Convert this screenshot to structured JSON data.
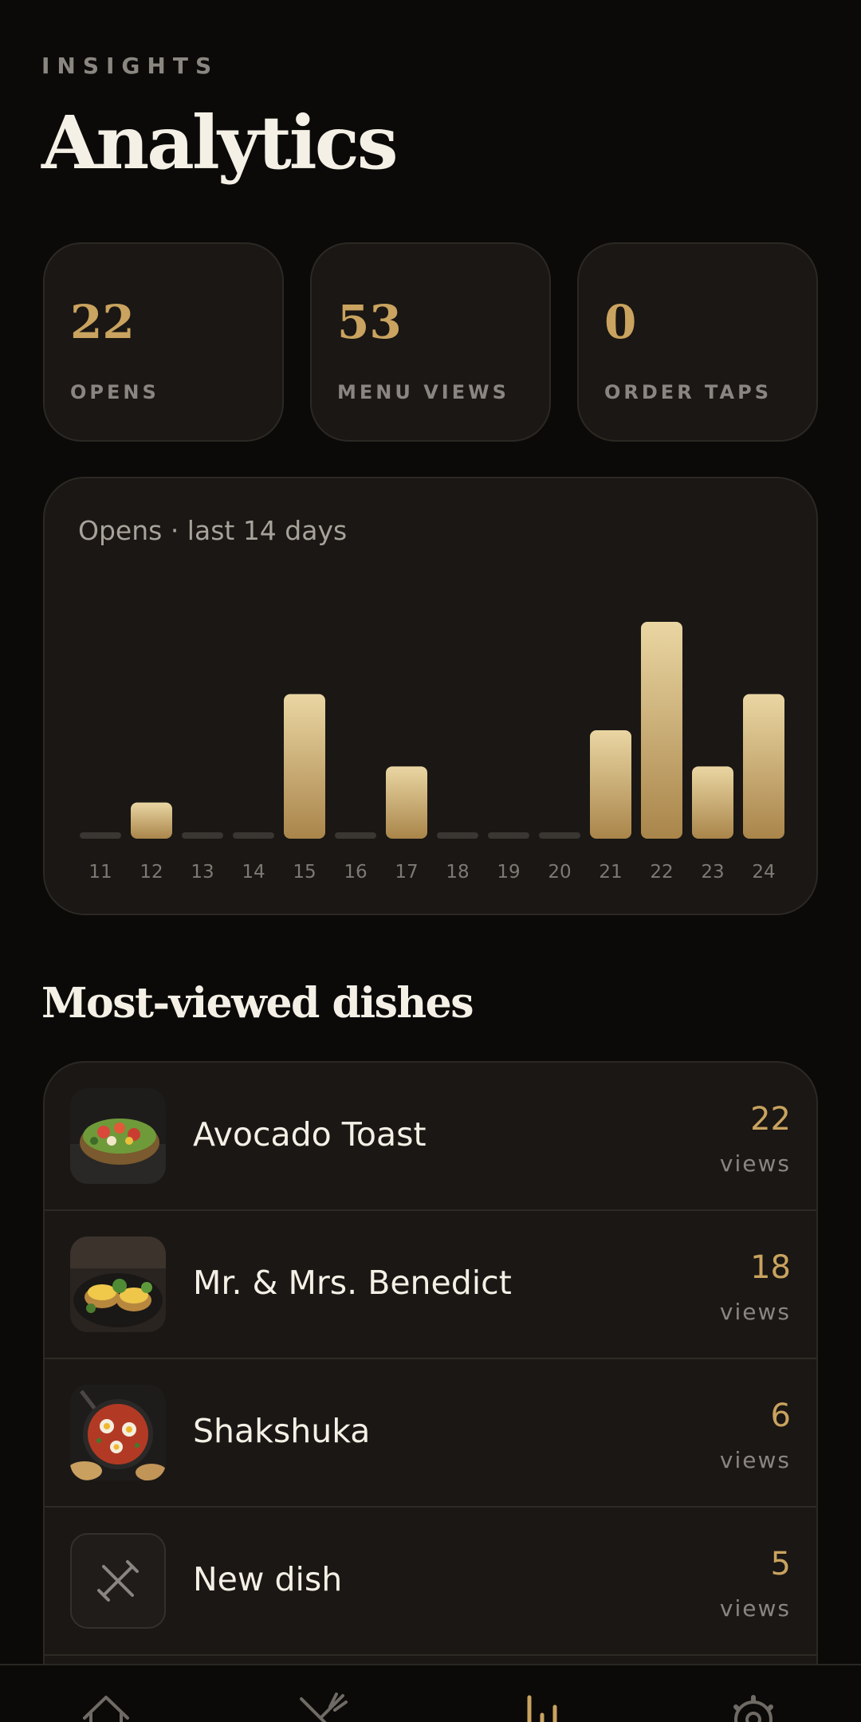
{
  "header": {
    "eyebrow": "INSIGHTS",
    "title": "Analytics"
  },
  "stats": [
    {
      "value": "22",
      "label": "OPENS"
    },
    {
      "value": "53",
      "label": "MENU VIEWS"
    },
    {
      "value": "0",
      "label": "ORDER TAPS"
    }
  ],
  "chart": {
    "title": "Opens · last 14 days"
  },
  "chart_data": {
    "type": "bar",
    "title": "Opens · last 14 days",
    "categories": [
      "11",
      "12",
      "13",
      "14",
      "15",
      "16",
      "17",
      "18",
      "19",
      "20",
      "21",
      "22",
      "23",
      "24"
    ],
    "values": [
      0,
      1,
      0,
      0,
      4,
      0,
      2,
      0,
      0,
      0,
      3,
      6,
      2,
      4
    ],
    "xlabel": "",
    "ylabel": "",
    "ylim": [
      0,
      6
    ],
    "grid": false,
    "colors": {
      "bar_top": "#ead6a3",
      "bar_bottom": "#a9854a",
      "zero_bar": "#3a3632"
    }
  },
  "most_viewed": {
    "title": "Most-viewed dishes",
    "dishes": [
      {
        "name": "Avocado Toast",
        "count": "22",
        "unit": "views",
        "thumb": "avocado-toast-photo"
      },
      {
        "name": "Mr. & Mrs. Benedict",
        "count": "18",
        "unit": "views",
        "thumb": "benedict-photo"
      },
      {
        "name": "Shakshuka",
        "count": "6",
        "unit": "views",
        "thumb": "shakshuka-photo"
      },
      {
        "name": "New dish",
        "count": "5",
        "unit": "views",
        "thumb": "fork-knife-icon"
      }
    ]
  },
  "nav": {
    "items": [
      {
        "name": "home",
        "icon": "home-icon",
        "active": false
      },
      {
        "name": "menu",
        "icon": "utensils-icon",
        "active": false
      },
      {
        "name": "analytics",
        "icon": "bar-chart-icon",
        "active": true
      },
      {
        "name": "settings",
        "icon": "gear-icon",
        "active": false
      }
    ]
  },
  "colors": {
    "background": "#0b0a09",
    "card": "#1a1714",
    "accent": "#c9a35f",
    "muted": "#8a8580"
  }
}
